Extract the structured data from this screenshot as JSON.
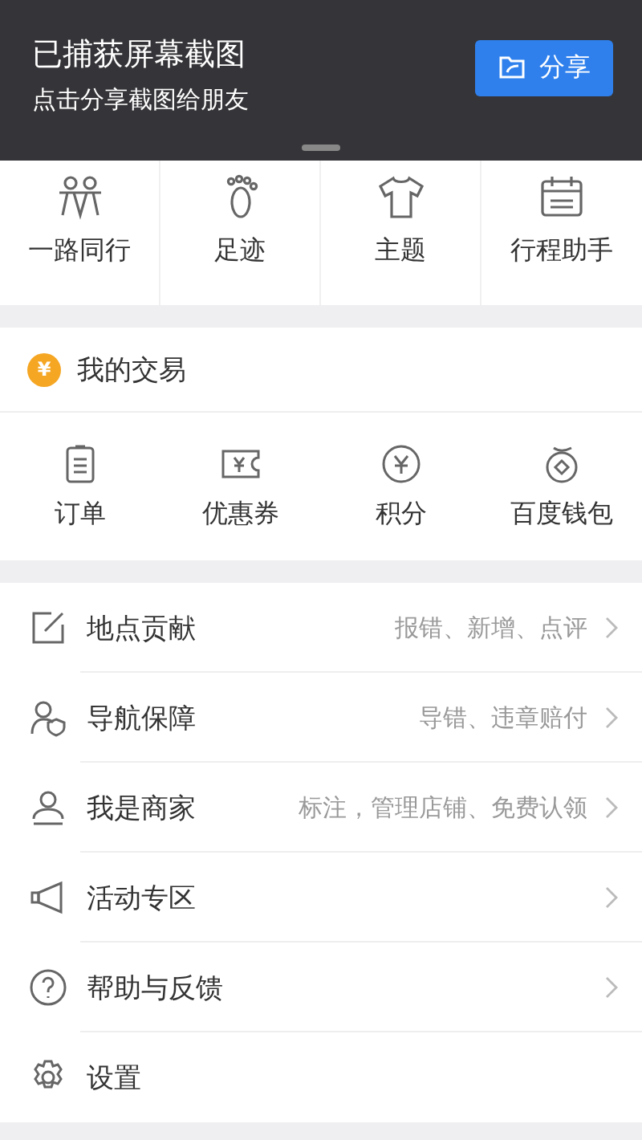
{
  "screenshot_toast": {
    "title": "已捕获屏幕截图",
    "subtitle": "点击分享截图给朋友",
    "share_button": "分享"
  },
  "shortcuts": [
    {
      "label": "一路同行",
      "kind": "people"
    },
    {
      "label": "足迹",
      "kind": "foot"
    },
    {
      "label": "主题",
      "kind": "shirt"
    },
    {
      "label": "行程助手",
      "kind": "calendar"
    }
  ],
  "trade": {
    "title": "我的交易",
    "icon": "¥",
    "items": [
      {
        "label": "订单",
        "kind": "order"
      },
      {
        "label": "优惠券",
        "kind": "coupon"
      },
      {
        "label": "积分",
        "kind": "coin"
      },
      {
        "label": "百度钱包",
        "kind": "wallet"
      }
    ]
  },
  "menu": [
    {
      "label": "地点贡献",
      "hint": "报错、新增、点评",
      "kind": "edit",
      "chevron": true
    },
    {
      "label": "导航保障",
      "hint": "导错、违章赔付",
      "kind": "shield",
      "chevron": true
    },
    {
      "label": "我是商家",
      "hint": "标注，管理店铺、免费认领",
      "kind": "merchant",
      "chevron": true
    },
    {
      "label": "活动专区",
      "kind": "speaker",
      "chevron": true
    },
    {
      "label": "帮助与反馈",
      "kind": "help",
      "chevron": true
    },
    {
      "label": "设置",
      "kind": "gear",
      "chevron": false
    }
  ]
}
